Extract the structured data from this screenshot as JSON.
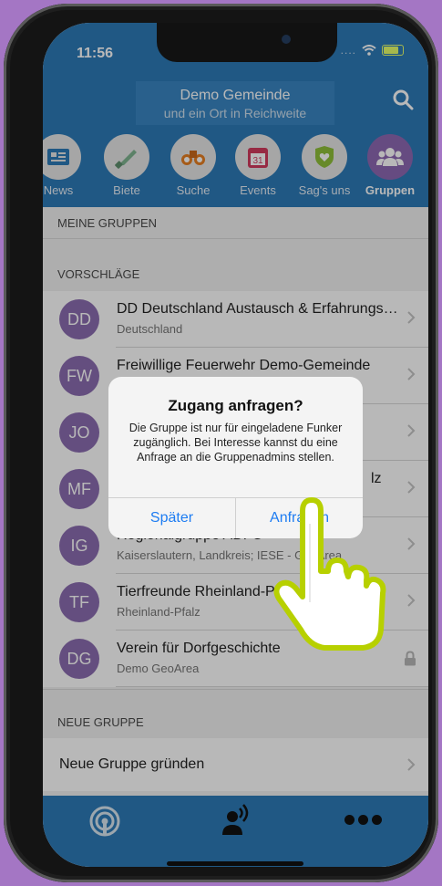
{
  "status_bar": {
    "time": "11:56",
    "signal": "....",
    "wifi_icon": "wifi-icon",
    "battery_icon": "battery-charging-icon"
  },
  "header": {
    "title": "Demo Gemeinde",
    "subtitle": "und ein Ort in Reichweite"
  },
  "tabs": [
    {
      "label": "News",
      "icon": "newspaper-icon"
    },
    {
      "label": "Biete",
      "icon": "saw-icon"
    },
    {
      "label": "Suche",
      "icon": "binoculars-icon"
    },
    {
      "label": "Events",
      "icon": "calendar-icon"
    },
    {
      "label": "Sag's uns",
      "icon": "shield-heart-icon"
    },
    {
      "label": "Gruppen",
      "icon": "people-icon",
      "active": true
    }
  ],
  "sections": {
    "my_groups": "MEINE GRUPPEN",
    "suggestions": "VORSCHLÄGE",
    "new_group": "NEUE GRUPPE"
  },
  "groups": [
    {
      "initials": "DD",
      "name": "DD Deutschland Austausch & Erfahrungsaustausch",
      "sub": "Deutschland",
      "accessory": "chevron"
    },
    {
      "initials": "FW",
      "name": "Freiwillige Feuerwehr Demo-Gemeinde",
      "sub": "",
      "accessory": "chevron"
    },
    {
      "initials": "JO",
      "name": "",
      "sub": "",
      "accessory": "chevron"
    },
    {
      "initials": "MF",
      "name": "lz",
      "sub": "",
      "accessory": "chevron"
    },
    {
      "initials": "IG",
      "name": "Regionalgruppe ADFC",
      "sub": "Kaiserslautern, Landkreis; IESE - GeoArea",
      "accessory": "chevron"
    },
    {
      "initials": "TF",
      "name": "Tierfreunde Rheinland-Pfalz",
      "sub": "Rheinland-Pfalz",
      "accessory": "chevron"
    },
    {
      "initials": "DG",
      "name": "Verein für Dorfgeschichte",
      "sub": "Demo GeoArea",
      "accessory": "lock"
    }
  ],
  "new_group": {
    "label": "Neue Gruppe gründen"
  },
  "bottom_tabs": [
    {
      "icon": "broadcast-icon"
    },
    {
      "icon": "person-speaking-icon"
    },
    {
      "icon": "more-dots-icon"
    }
  ],
  "alert": {
    "title": "Zugang anfragen?",
    "message": "Die Gruppe ist nur für eingeladene Funker zugänglich. Bei Interesse kannst du eine Anfrage an die Gruppenadmins stellen.",
    "cancel": "Später",
    "confirm": "Anfragen"
  },
  "colors": {
    "primary": "#2d7ab8",
    "avatar": "#8b6cb0",
    "accent": "#1d7cf2",
    "background": "#a476c4",
    "hand_outline": "#b7d000"
  }
}
